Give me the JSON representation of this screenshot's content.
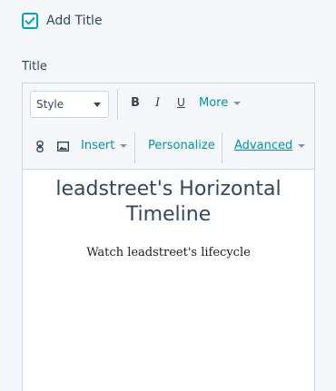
{
  "add_title": {
    "label": "Add Title",
    "checked": true
  },
  "field": {
    "label": "Title"
  },
  "toolbar": {
    "style_select": "Style",
    "bold": "B",
    "italic": "I",
    "underline": "U",
    "more": "More",
    "insert": "Insert",
    "personalize": "Personalize",
    "advanced": "Advanced"
  },
  "content": {
    "heading": "leadstreet's Horizontal Timeline",
    "subtitle": "Watch leadstreet's lifecycle"
  },
  "colors": {
    "accent": "#00a4bd",
    "link": "#0091ae",
    "text": "#33475b"
  }
}
